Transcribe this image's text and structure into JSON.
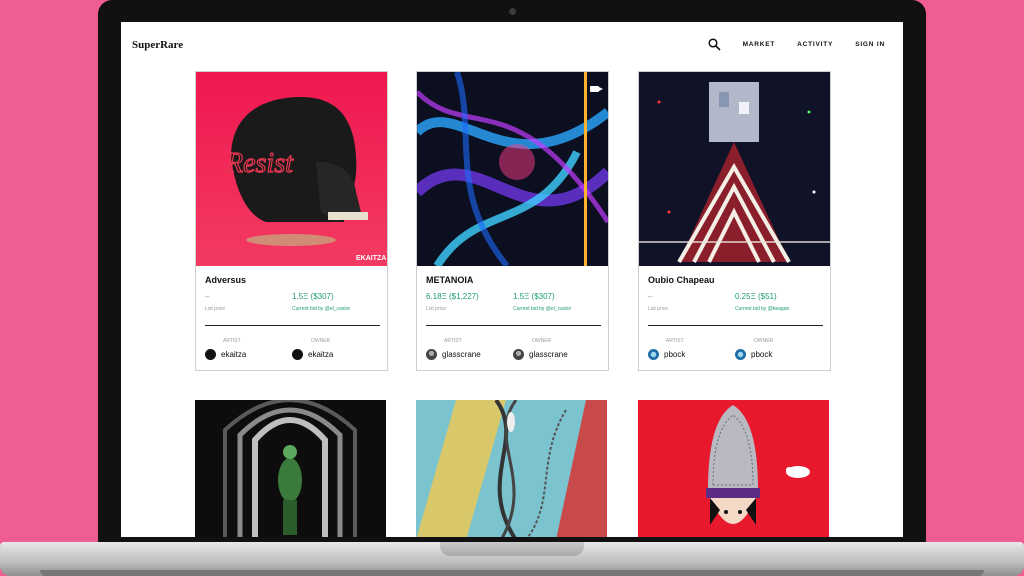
{
  "header": {
    "logo": "SuperRare",
    "nav": {
      "market": "MARKET",
      "activity": "ACTIVITY",
      "sign_in": "SIGN IN"
    }
  },
  "cards": [
    {
      "title": "Adversus",
      "list_price": "–",
      "list_label": "List price",
      "bid_price": "1.5Ξ ($307)",
      "bid_label": "Current bid by @el_castor",
      "artist_label": "ARTIST",
      "owner_label": "OWNER",
      "artist": "ekaitza",
      "owner": "ekaitza"
    },
    {
      "title": "METANOIA",
      "list_price": "6.18Ξ ($1,227)",
      "list_label": "List price",
      "bid_price": "1.5Ξ ($307)",
      "bid_label": "Current bid by @el_castor",
      "artist_label": "ARTIST",
      "owner_label": "OWNER",
      "artist": "glasscrane",
      "owner": "glasscrane"
    },
    {
      "title": "Oubio Chapeau",
      "list_price": "–",
      "list_label": "List price",
      "bid_price": "0.25Ξ ($51)",
      "bid_label": "Current bid by @keagan",
      "artist_label": "ARTIST",
      "owner_label": "OWNER",
      "artist": "pbock",
      "owner": "pbock"
    }
  ],
  "art_signature": "EKAITZA",
  "skull_text": "Resist"
}
